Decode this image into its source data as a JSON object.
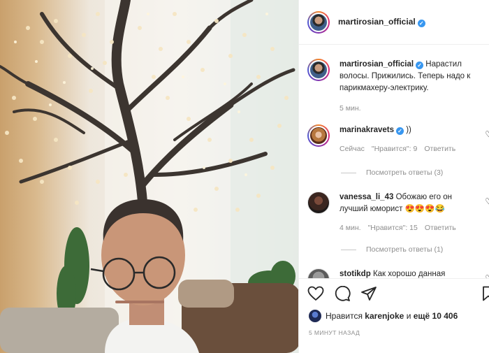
{
  "post": {
    "author": "martirosian_official",
    "caption": "Нарастил волосы. Прижились. Теперь надо к парикмахеру-электрику.",
    "caption_time": "5 мин."
  },
  "comments": [
    {
      "user": "marinakravets",
      "verified": true,
      "text": "))",
      "time": "Сейчас",
      "likes": "\"Нравится\": 9",
      "reply": "Ответить",
      "view_replies": "Посмотреть ответы (3)"
    },
    {
      "user": "vanessa_li_43",
      "verified": false,
      "text": "Обожаю его он лучший юморист 😍😍😍😂",
      "time": "4 мин.",
      "likes": "\"Нравится\": 15",
      "reply": "Ответить",
      "view_replies": "Посмотреть ответы (1)"
    },
    {
      "user": "stotikdp",
      "verified": false,
      "text": "Как хорошо данная"
    }
  ],
  "footer": {
    "likes_prefix": "Нравится",
    "likes_user": "karenjoke",
    "likes_and": "и",
    "likes_more": "ещё 10 406",
    "timestamp": "5 минут назад"
  },
  "icons": {
    "like": "heart-icon",
    "comment": "comment-icon",
    "share": "share-icon",
    "save": "bookmark-icon",
    "verified": "verified-badge-icon"
  },
  "colors": {
    "verified": "#3897f0",
    "muted_text": "#8e8e8e",
    "text": "#262626",
    "divider": "#efefef"
  }
}
